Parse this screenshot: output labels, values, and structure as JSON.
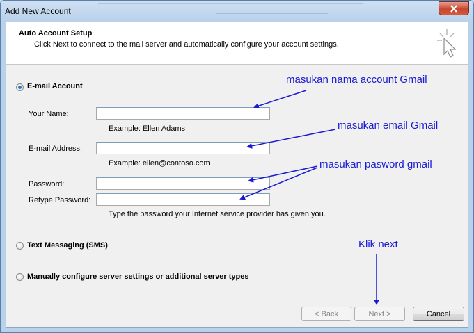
{
  "window": {
    "title": "Add New Account"
  },
  "header": {
    "title": "Auto Account Setup",
    "subtitle": "Click Next to connect to the mail server and automatically configure your account settings."
  },
  "options": {
    "email": {
      "label": "E-mail Account",
      "selected": true
    },
    "sms": {
      "label": "Text Messaging (SMS)",
      "selected": false
    },
    "manual": {
      "label": "Manually configure server settings or additional server types",
      "selected": false
    }
  },
  "form": {
    "name": {
      "label": "Your Name:",
      "value": "",
      "hint": "Example: Ellen Adams"
    },
    "email": {
      "label": "E-mail Address:",
      "value": "",
      "hint": "Example: ellen@contoso.com"
    },
    "password": {
      "label": "Password:",
      "value": ""
    },
    "retype": {
      "label": "Retype Password:",
      "value": "",
      "hint": "Type the password your Internet service provider has given you."
    }
  },
  "buttons": {
    "back": "< Back",
    "next": "Next >",
    "cancel": "Cancel"
  },
  "annotations": {
    "name": "masukan nama account Gmail",
    "email": "masukan email Gmail",
    "password": "masukan pasword gmail",
    "next": "Klik next"
  },
  "colors": {
    "annotation": "#1a1ad6",
    "radio_selected": "#2a7bd0",
    "close_button": "#c8452f"
  },
  "icons": {
    "close": "close-icon",
    "header": "cursor-click-icon"
  }
}
